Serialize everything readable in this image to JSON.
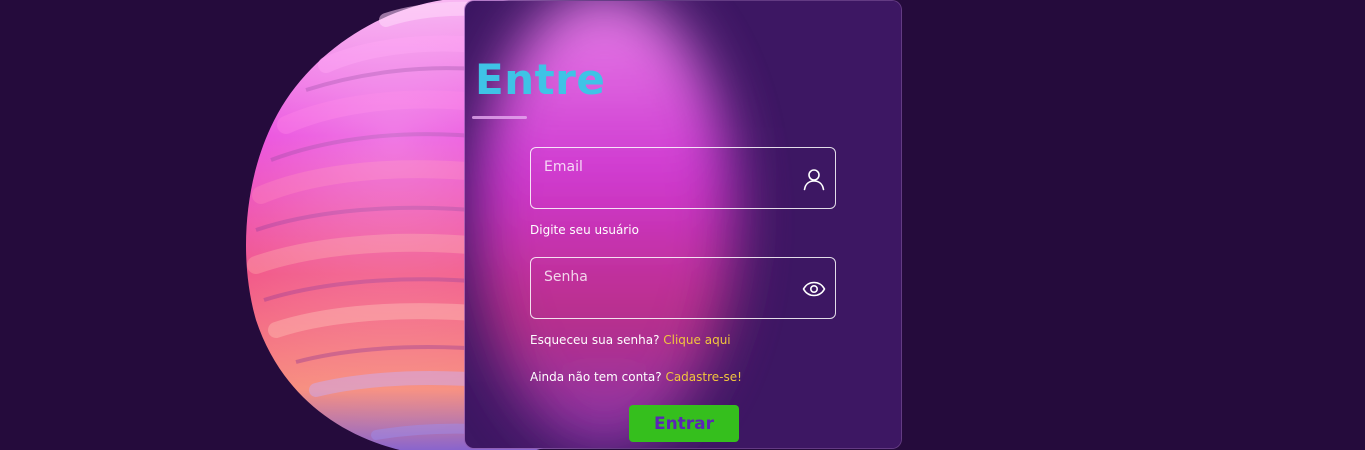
{
  "login": {
    "title": "Entre",
    "email": {
      "label": "Email",
      "value": "",
      "helper": "Digite seu usuário",
      "icon": "user-icon"
    },
    "password": {
      "label": "Senha",
      "value": "",
      "icon": "eye-icon"
    },
    "forgot": {
      "text": "Esqueceu sua senha?",
      "link": "Clique aqui"
    },
    "signup": {
      "text": "Ainda não tem conta?",
      "link": "Cadastre-se!"
    },
    "submit_label": "Entrar"
  },
  "colors": {
    "background": "#250b3c",
    "card": "#5a148c",
    "title": "#3fc3e6",
    "link": "#f2c63d",
    "button": "#35bf1d",
    "button_text": "#5b26b5"
  }
}
